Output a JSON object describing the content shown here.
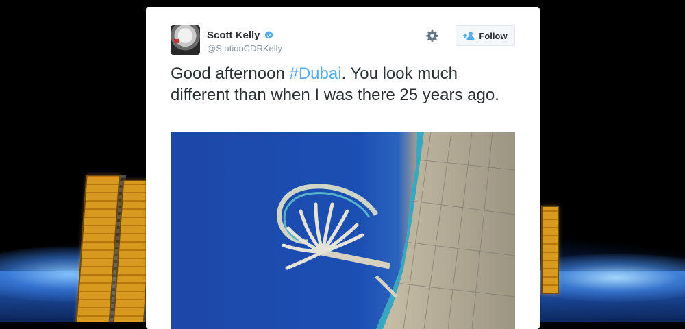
{
  "tweet": {
    "author": {
      "display_name": "Scott Kelly",
      "handle": "@StationCDRKelly",
      "verified": true,
      "avatar_icon": "astronaut-avatar"
    },
    "actions": {
      "follow_label": "Follow",
      "follow_icon": "add-user-icon",
      "settings_icon": "gear-icon"
    },
    "text": {
      "prefix": "Good afternoon ",
      "hashtag": "#Dubai",
      "suffix": ". You look much different than when I was there 25 years ago."
    },
    "media": {
      "type": "photo",
      "subject_icon": "satellite-photo"
    }
  },
  "colors": {
    "hashtag": "#55acee",
    "verified_badge": "#55acee",
    "text": "#292f33",
    "handle": "#8899a6",
    "card_bg": "#ffffff"
  }
}
